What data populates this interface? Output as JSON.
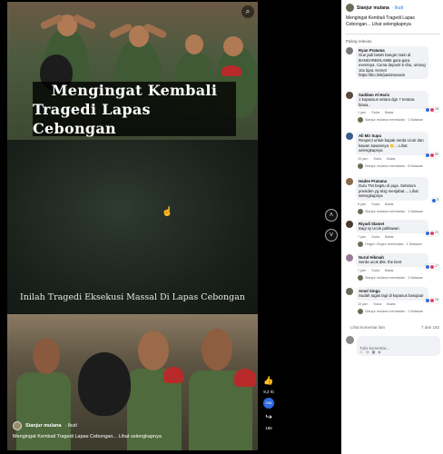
{
  "video": {
    "title_line1": "Mengingat Kembali",
    "title_line2": "Tragedi Lapas Cebongan",
    "subtitle": "Inilah Tragedi Eksekusi Massal Di Lapas Cebongan",
    "poster_name": "Sianjur mulana",
    "poster_follow": "· Ikuti",
    "caption": "Mengingat Kembali Tragedi Lapas Cebongan... Lihat selengkapnya"
  },
  "actions": {
    "likes": "9,2 rb",
    "comments": "206",
    "shares": "186"
  },
  "panel": {
    "author": "Sianjur mulana",
    "follow": "· Ikuti",
    "description": "Mengingat Kembali Tragedi Lapas Cebongan... Lihat selengkapnya",
    "sort_label": "Paling relevan",
    "more_comments": "Lihat komentar lain",
    "comment_count": "7 dari 182",
    "input_placeholder": "Tulis komentar..."
  },
  "comments": [
    {
      "name": "Ryan Pratama",
      "text": "Gue jadi betah banget main di BANDARBOLA855 gara-gara eventnya. Cuma deposit 5 ribu, untung 10x lipat. Keren! https://bio.link/pastimaxwin",
      "time": "",
      "like": "",
      "reply": "",
      "reactions": "",
      "reply_line": "",
      "avatar_color": "#7a7a7a"
    },
    {
      "name": "Saddam Al Haris",
      "text": "1 kopassus setara dgn 7 tentara biasa..",
      "time": "1 jam",
      "like": "Suka",
      "reply": "Balas",
      "reactions": "18",
      "reply_line": "Sianjur mulana membalas · 1 Balasan",
      "avatar_color": "#5a4a3a"
    },
    {
      "name": "Ali Mir Supu",
      "text": "Respect untuk bapak serda Ucok dan kawan kawannya 👏... Lihat selengkapnya",
      "time": "10 jam",
      "like": "Suka",
      "reply": "Balas",
      "reactions": "50",
      "reply_line": "Sianjur mulana membalas · 8 Balasan",
      "avatar_color": "#3b5b8a"
    },
    {
      "name": "Hadee Pratama",
      "text": "Dulu TNI begitu di puja. Sebelum presiden yg skrg menjabat.... Lihat selengkapnya",
      "time": "5 jam",
      "like": "Suka",
      "reply": "Balas",
      "reactions": "5",
      "reply_line": "Sianjur mulana membalas · 1 Balasan",
      "avatar_color": "#8a6a4a"
    },
    {
      "name": "Riyadi Slamet",
      "text": "Bagi sy Ucok pahlawan",
      "time": "7 jam",
      "like": "Suka",
      "reply": "Balas",
      "reactions": "21",
      "reply_line": "Ongen Ongen membalas · 1 Balasan",
      "avatar_color": "#4a3a2a"
    },
    {
      "name": "Nurul Hikmah",
      "text": "Serda ucok dkk. the best",
      "time": "7 jam",
      "like": "Suka",
      "reply": "Balas",
      "reactions": "17",
      "reply_line": "Sianjur mulana membalas · 1 Balasan",
      "avatar_color": "#9a7a9a"
    },
    {
      "name": "Amol Singa",
      "text": "Sudah tugas lagi di kopasus basujaar",
      "time": "10 jam",
      "like": "Suka",
      "reply": "Balas",
      "reactions": "16",
      "reply_line": "Sianjur mulana membalas · 1 Balasan",
      "avatar_color": "#6a6a5a"
    }
  ],
  "colors": {
    "accent": "#1b74e4",
    "like": "#2d6cdf",
    "love": "#e4405f",
    "panel_bg": "#ffffff",
    "viewer_bg": "#000000"
  },
  "icons": {
    "close": "close-icon",
    "settings": "settings-icon",
    "search": "search-icon",
    "like": "thumbs-up-icon",
    "comment": "comment-icon",
    "share": "share-icon",
    "nav_up": "chevron-up-icon",
    "nav_down": "chevron-down-icon"
  }
}
